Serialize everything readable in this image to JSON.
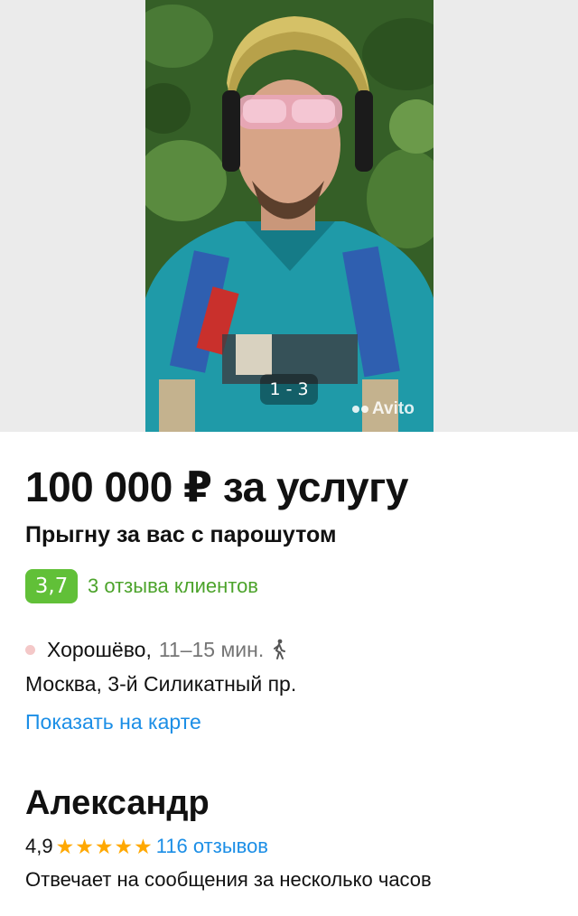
{
  "gallery": {
    "counter": "1 - 3",
    "watermark": "Avito"
  },
  "listing": {
    "price": "100 000 ₽ за услугу",
    "title": "Прыгну за вас с парошутом",
    "rating_value": "3,7",
    "rating_reviews": "3 отзыва клиентов"
  },
  "address": {
    "metro_name": "Хорошёво,",
    "metro_time": "11–15 мин.",
    "street": "Москва, 3-й Силикатный пр.",
    "map_link": "Показать на карте",
    "metro_dot_color": "#f4c8c8"
  },
  "seller": {
    "name": "Александр",
    "score": "4,9",
    "stars": 5,
    "reviews": "116 отзывов",
    "response": "Отвечает на сообщения за несколько часов"
  },
  "colors": {
    "rating_badge": "#61c038",
    "link_blue": "#1b8ee6",
    "rating_link_green": "#4ca32b",
    "star": "#ffa800"
  },
  "icons": [
    "walk-icon",
    "star-icon",
    "metro-dot-icon"
  ]
}
